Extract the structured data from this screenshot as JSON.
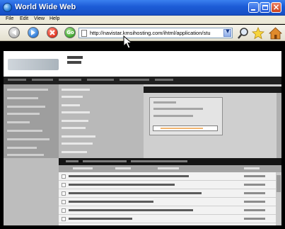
{
  "window": {
    "title": "World Wide Web",
    "controls": {
      "minimize": "",
      "maximize": "",
      "close": "×"
    }
  },
  "menu": [
    "File",
    "Edit",
    "View",
    "Help"
  ],
  "toolbar": {
    "go_label": "Go",
    "address": "http://navistar.kmsihosting.com/ihtml/application/stu",
    "icons": [
      "back-icon",
      "forward-icon",
      "stop-icon",
      "go-icon",
      "search-icon",
      "favorites-star-icon",
      "home-icon"
    ]
  },
  "colors": {
    "titlebar": "#1c5bd6",
    "toolbar": "#ece9d8",
    "page_background": "#bdbdbd"
  }
}
